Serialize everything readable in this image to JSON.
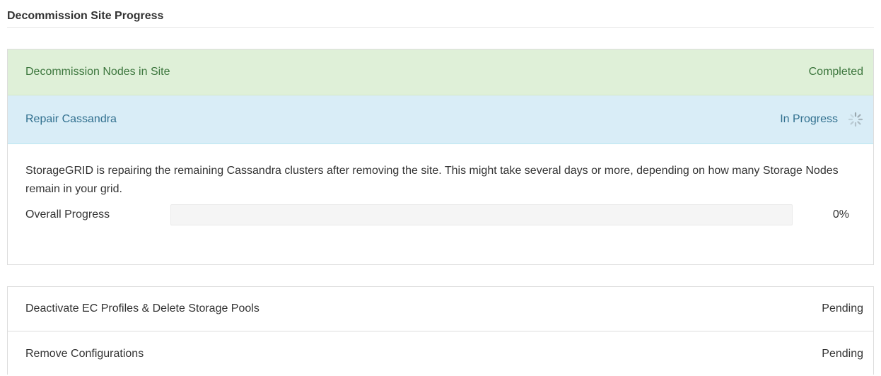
{
  "page": {
    "title": "Decommission Site Progress"
  },
  "steps": [
    {
      "label": "Decommission Nodes in Site",
      "status": "Completed",
      "state": "completed"
    },
    {
      "label": "Repair Cassandra",
      "status": "In Progress",
      "state": "in-progress"
    },
    {
      "label": "Deactivate EC Profiles & Delete Storage Pools",
      "status": "Pending",
      "state": "pending"
    },
    {
      "label": "Remove Configurations",
      "status": "Pending",
      "state": "pending"
    }
  ],
  "repair_detail": {
    "description": "StorageGRID is repairing the remaining Cassandra clusters after removing the site. This might take several days or more, depending on how many Storage Nodes remain in your grid.",
    "progress_label": "Overall Progress",
    "progress_percent": 0,
    "progress_text": "0%"
  },
  "colors": {
    "completed_bg": "#dff0d8",
    "completed_text": "#3c763d",
    "in_progress_bg": "#d9edf7",
    "in_progress_text": "#31708f",
    "progress_fill": "#337ab7"
  },
  "icons": {
    "spinner": "loading-spinner-icon"
  }
}
